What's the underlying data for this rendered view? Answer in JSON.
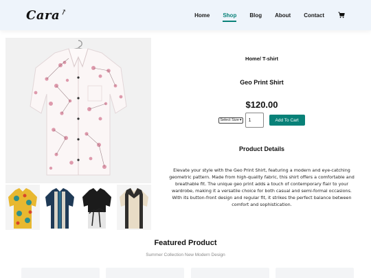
{
  "header": {
    "logo": "Cara",
    "nav": [
      "Home",
      "Shop",
      "Blog",
      "About",
      "Contact"
    ],
    "active_nav": "Shop",
    "cart_icon": "cart-icon"
  },
  "product": {
    "breadcrumb": "Home/ T-shirt",
    "title": "Geo Print Shirt",
    "price": "$120.00",
    "size_select": "Select Size",
    "quantity": "1",
    "add_to_cart": "Add To Cart",
    "details_heading": "Product Details",
    "description": "Elevate your style with the Geo Print Shirt, featuring a modern and eye-catching geometric pattern. Made from high-quality fabric, this shirt offers a comfortable and breathable fit. The unique geo print adds a touch of contemporary flair to your wardrobe, making it a versatile choice for both casual and semi-formal occasions. With its button-front design and regular fit, it strikes the perfect balance between comfort and sophistication."
  },
  "featured": {
    "title": "Featured Product",
    "subtitle": "Summer Collection New Modern Design"
  },
  "colors": {
    "accent": "#088178",
    "header_bg": "#eef4fb"
  }
}
